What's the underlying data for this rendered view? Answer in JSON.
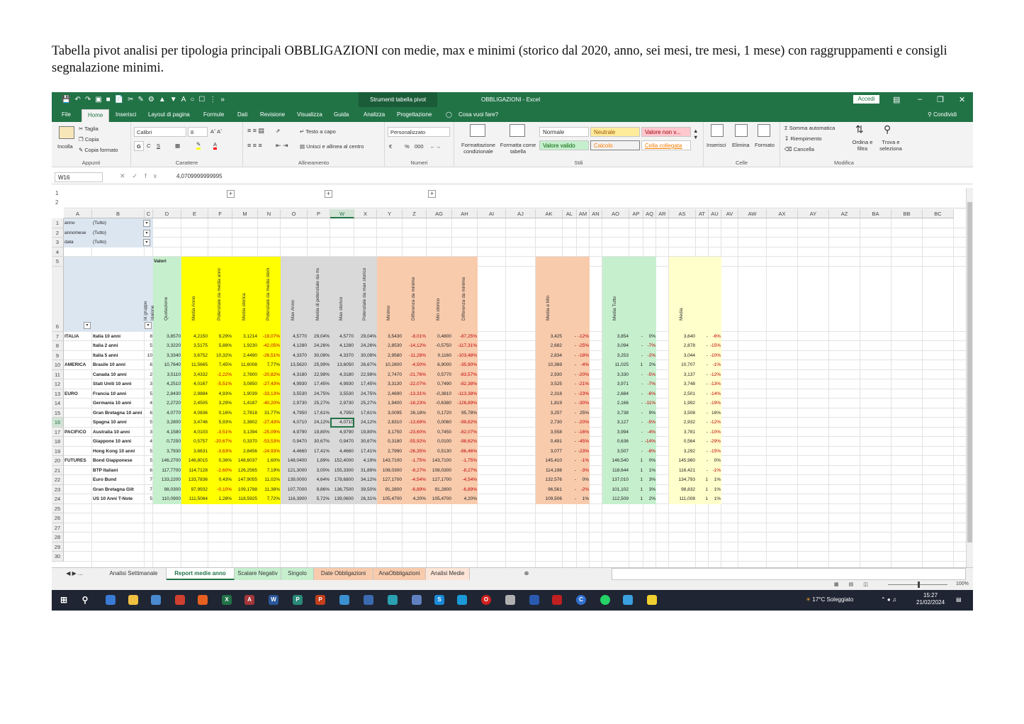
{
  "intro_text": "Tabella pivot analisi per tipologia principali OBBLIGAZIONI con medie, max e minimi (storico dal 2020, anno, sei mesi, tre mesi, 1 mese) con raggruppamenti e consigli segnalazione minimi.",
  "window": {
    "context_tab": "Strumenti tabella pivot",
    "title": "OBBLIGAZIONI - Excel",
    "signin": "Accedi",
    "share": "Condividi",
    "search": "Cosa vuoi fare?"
  },
  "ribbon_tabs": [
    "File",
    "Home",
    "Inserisci",
    "Layout di pagina",
    "Formule",
    "Dati",
    "Revisione",
    "Visualizza",
    "Guida",
    "Analizza",
    "Progettazione"
  ],
  "ribbon": {
    "clipboard": {
      "label": "Appunti",
      "paste": "Incolla",
      "cut": "Taglia",
      "copy": "Copia",
      "format_painter": "Copia formato"
    },
    "font": {
      "label": "Carattere",
      "name": "Calibri",
      "size": "8",
      "bold": "G",
      "italic": "C",
      "underline": "S"
    },
    "alignment": {
      "label": "Allineamento",
      "wrap": "Testo a capo",
      "merge": "Unisci e allinea al centro"
    },
    "number": {
      "label": "Numeri",
      "format": "Personalizzato",
      "percent": "%",
      "thousands": "000"
    },
    "styles": {
      "label": "Stili",
      "cond_format": "Formattazione condizionale",
      "format_table": "Formatta come tabella",
      "normale": "Normale",
      "neutrale": "Neutrale",
      "non_valido": "Valore non v...",
      "valido": "Valore valido",
      "calcolo": "Calcolo",
      "collegata": "Cella collegata"
    },
    "cells": {
      "label": "Celle",
      "insert": "Inserisci",
      "delete": "Elimina",
      "format": "Formato"
    },
    "editing": {
      "label": "Modifica",
      "autosum": "Somma automatica",
      "fill": "Riempimento",
      "clear": "Cancella",
      "sort": "Ordina e filtra",
      "find": "Trova e seleziona"
    }
  },
  "formula_bar": {
    "name_box": "W16",
    "fx": "fx",
    "value": "4,0709999999995"
  },
  "columns": [
    "A",
    "B",
    "C",
    "D",
    "E",
    "F",
    "M",
    "N",
    "O",
    "P",
    "W",
    "X",
    "Y",
    "Z",
    "AG",
    "AH",
    "AI",
    "AJ",
    "AK",
    "AL",
    "AM",
    "AN",
    "AO",
    "AP",
    "AQ",
    "AR",
    "AS",
    "AT",
    "AU",
    "AV",
    "AW",
    "AX",
    "AY",
    "AZ",
    "BA",
    "BB",
    "BC"
  ],
  "row_numbers": [
    "1",
    "2",
    "3",
    "4",
    "5",
    "6",
    "7",
    "8",
    "9",
    "10",
    "11",
    "12",
    "13",
    "14",
    "15",
    "16",
    "17",
    "18",
    "19",
    "20",
    "21",
    "22",
    "23",
    "24",
    "25",
    "26",
    "27",
    "28",
    "29",
    "30"
  ],
  "outline_levels": [
    "1",
    "2"
  ],
  "filters": [
    {
      "field": "anno",
      "value": "(Tutto)"
    },
    {
      "field": "annomese",
      "value": "(Tutto)"
    },
    {
      "field": "data",
      "value": "(Tutto)"
    }
  ],
  "values_label": "Valori",
  "headers": {
    "C": "Id gruppo",
    "C2": "Idalone",
    "D": "Quotazione",
    "E": "Media Anno",
    "F": "Potenziale da media anno",
    "M": "Media storica",
    "N": "Potenziale da media storica",
    "O": "Max Anno",
    "P": "Media di potenziale da max",
    "W": "Max storico",
    "X": "Potenziale da max storico",
    "Y": "Minimo",
    "Z": "Differenza da minimo",
    "AG": "Min storico",
    "AH": "Differenza da minimo",
    "AK": "Media e Min",
    "AO": "Media Tutto",
    "AS": "Media"
  },
  "rows": [
    {
      "r": "7",
      "g": "ITALIA",
      "b": "Italia 10 anni",
      "c": "8",
      "d": "3,8570",
      "e": "4,2150",
      "f": "9,29%",
      "m": "3,1214",
      "n": "-19,07%",
      "o": "4,5770",
      "p": "29,04%",
      "w": "4,5770",
      "x": "29,04%",
      "y": "3,5430",
      "z": "-8,01%",
      "ag": "0,4800",
      "ah": "-87,25%",
      "ak": "3,425",
      "al": "-",
      "am": "-12%",
      "ao": "3,854",
      "ap": "-",
      "aq": "0%",
      "as": "3,640",
      "at": "-",
      "au": "-6%"
    },
    {
      "r": "8",
      "g": "",
      "b": "Italia 2 anni",
      "c": "5",
      "d": "3,3220",
      "e": "3,5175",
      "f": "5,88%",
      "m": "1,9230",
      "n": "-42,05%",
      "o": "4,1280",
      "p": "24,26%",
      "w": "4,1280",
      "x": "24,26%",
      "y": "2,8530",
      "z": "-14,12%",
      "ag": "-0,5750",
      "ah": "-117,31%",
      "ak": "2,682",
      "al": "-",
      "am": "-25%",
      "ao": "3,094",
      "ap": "-",
      "aq": "-7%",
      "as": "2,878",
      "at": "-",
      "au": "-15%"
    },
    {
      "r": "9",
      "g": "",
      "b": "Italia 5 anni",
      "c": "10",
      "d": "3,3340",
      "e": "3,6752",
      "f": "10,32%",
      "m": "2,4490",
      "n": "-26,51%",
      "o": "4,3370",
      "p": "30,08%",
      "w": "4,3370",
      "x": "30,08%",
      "y": "2,9580",
      "z": "-11,28%",
      "ag": "0,1160",
      "ah": "-103,48%",
      "ak": "2,834",
      "al": "-",
      "am": "-18%",
      "ao": "3,253",
      "ap": "-",
      "aq": "-2%",
      "as": "3,044",
      "at": "-",
      "au": "-10%"
    },
    {
      "r": "10",
      "g": "AMERICA",
      "b": "Brasile 10 anni",
      "c": "6",
      "d": "10,7640",
      "e": "11,5665",
      "f": "7,45%",
      "m": "11,6008",
      "n": "7,77%",
      "o": "13,5620",
      "p": "25,99%",
      "w": "13,6050",
      "x": "26,67%",
      "y": "10,2800",
      "z": "-4,50%",
      "ag": "6,9000",
      "ah": "-35,90%",
      "ak": "10,369",
      "al": "-",
      "am": "-4%",
      "ao": "11,025",
      "ap": "1",
      "aq": "2%",
      "as": "10,707",
      "at": "-",
      "au": "-1%"
    },
    {
      "r": "11",
      "g": "",
      "b": "Canada 10 anni",
      "c": "2",
      "d": "3,5110",
      "e": "3,4332",
      "f": "-2,22%",
      "m": "2,7800",
      "n": "-20,82%",
      "o": "4,3180",
      "p": "22,98%",
      "w": "4,3180",
      "x": "22,98%",
      "y": "2,7470",
      "z": "-21,76%",
      "ag": "0,5770",
      "ah": "-83,57%",
      "ak": "2,930",
      "al": "-",
      "am": "-20%",
      "ao": "3,330",
      "ap": "-",
      "aq": "-5%",
      "as": "3,137",
      "at": "-",
      "au": "-12%"
    },
    {
      "r": "12",
      "g": "",
      "b": "Stati Uniti 10 anni",
      "c": "3",
      "d": "4,2510",
      "e": "4,0167",
      "f": "-5,51%",
      "m": "3,0850",
      "n": "-27,43%",
      "o": "4,9930",
      "p": "17,45%",
      "w": "4,9930",
      "x": "17,45%",
      "y": "3,3130",
      "z": "-22,07%",
      "ag": "0,7490",
      "ah": "-82,38%",
      "ak": "3,525",
      "al": "-",
      "am": "-21%",
      "ao": "3,971",
      "ap": "-",
      "aq": "-7%",
      "as": "3,748",
      "at": "-",
      "au": "-13%"
    },
    {
      "r": "13",
      "g": "EURO",
      "b": "Francia 10 anni",
      "c": "5",
      "d": "2,8430",
      "e": "2,9884",
      "f": "4,93%",
      "m": "1,9039",
      "n": "-33,13%",
      "o": "3,5530",
      "p": "24,75%",
      "w": "3,5530",
      "x": "24,75%",
      "y": "2,4690",
      "z": "-13,31%",
      "ag": "-0,3810",
      "ah": "-113,38%",
      "ak": "2,318",
      "al": "-",
      "am": "-23%",
      "ao": "2,684",
      "ap": "-",
      "aq": "-6%",
      "as": "2,501",
      "at": "-",
      "au": "-14%"
    },
    {
      "r": "14",
      "g": "",
      "b": "Germania 10 anni",
      "c": "4",
      "d": "2,2720",
      "e": "2,4505",
      "f": "3,29%",
      "m": "1,4187",
      "n": "-40,20%",
      "o": "2,9730",
      "p": "25,27%",
      "w": "2,9730",
      "x": "25,27%",
      "y": "1,9400",
      "z": "-18,23%",
      "ag": "-0,6380",
      "ah": "-126,89%",
      "ak": "1,819",
      "al": "-",
      "am": "-30%",
      "ao": "2,166",
      "ap": "-",
      "aq": "-11%",
      "as": "1,992",
      "at": "-",
      "au": "-19%"
    },
    {
      "r": "15",
      "g": "",
      "b": "Gran Bretagna 10 anni",
      "c": "6",
      "d": "4,0770",
      "e": "4,0836",
      "f": "0,16%",
      "m": "2,7818",
      "n": "31,77%",
      "o": "4,7950",
      "p": "17,61%",
      "w": "4,7950",
      "x": "17,61%",
      "y": "3,0095",
      "z": "26,18%",
      "ag": "0,1720",
      "ah": "95,78%",
      "ak": "3,257",
      "al": "-",
      "am": "25%",
      "ao": "3,738",
      "ap": "-",
      "aq": "9%",
      "as": "3,508",
      "at": "-",
      "au": "16%"
    },
    {
      "r": "16",
      "g": "",
      "b": "Spagna 10 anni",
      "c": "5",
      "d": "3,2800",
      "e": "3,4746",
      "f": "5,93%",
      "m": "2,3802",
      "n": "-27,43%",
      "o": "4,0710",
      "p": "24,12%",
      "w": "4,0710",
      "x": "24,12%",
      "y": "2,8310",
      "z": "-13,69%",
      "ag": "0,0060",
      "ah": "-99,82%",
      "ak": "2,730",
      "al": "-",
      "am": "-20%",
      "ao": "3,127",
      "ap": "-",
      "aq": "-5%",
      "as": "2,932",
      "at": "-",
      "au": "-12%"
    },
    {
      "r": "17",
      "g": "PACIFICO",
      "b": "Australia 10 anni",
      "c": "3",
      "d": "4,1580",
      "e": "4,0103",
      "f": "-3,51%",
      "m": "3,1394",
      "n": "-25,09%",
      "o": "4,9790",
      "p": "19,80%",
      "w": "4,9790",
      "x": "19,80%",
      "y": "3,1750",
      "z": "-23,60%",
      "ag": "0,7450",
      "ah": "-82,07%",
      "ak": "3,558",
      "al": "-",
      "am": "-16%",
      "ao": "3,994",
      "ap": "-",
      "aq": "-4%",
      "as": "3,781",
      "at": "-",
      "au": "-10%"
    },
    {
      "r": "18",
      "g": "",
      "b": "Giappone 10 anni",
      "c": "4",
      "d": "0,7250",
      "e": "0,5757",
      "f": "-20,67%",
      "m": "0,3370",
      "n": "-53,53%",
      "o": "0,9470",
      "p": "30,67%",
      "w": "0,9470",
      "x": "30,67%",
      "y": "0,3180",
      "z": "-55,92%",
      "ag": "0,0100",
      "ah": "-98,62%",
      "ak": "0,491",
      "al": "-",
      "am": "-45%",
      "ao": "0,636",
      "ap": "-",
      "aq": "-14%",
      "as": "0,564",
      "at": "-",
      "au": "-29%"
    },
    {
      "r": "19",
      "g": "",
      "b": "Hong Kong 10 anni",
      "c": "5",
      "d": "3,7930",
      "e": "3,6631",
      "f": "-3,63%",
      "m": "2,8456",
      "n": "-24,93%",
      "o": "4,4660",
      "p": "17,41%",
      "w": "4,4660",
      "x": "17,41%",
      "y": "2,7990",
      "z": "-26,35%",
      "ag": "0,5130",
      "ah": "-86,46%",
      "ak": "3,077",
      "al": "-",
      "am": "-23%",
      "ao": "3,507",
      "ap": "-",
      "aq": "-8%",
      "as": "3,292",
      "at": "-",
      "au": "-15%"
    },
    {
      "r": "20",
      "g": "FUTURES",
      "b": "Bond Giapponese",
      "c": "5",
      "d": "146,2700",
      "e": "146,8015",
      "f": "0,36%",
      "m": "148,6037",
      "n": "1,60%",
      "o": "148,0400",
      "p": "1,89%",
      "w": "152,4000",
      "x": "4,19%",
      "y": "143,7100",
      "z": "-1,75%",
      "ag": "143,7100",
      "ah": "-1,75%",
      "ak": "145,410",
      "al": "-",
      "am": "-1%",
      "ao": "146,540",
      "ap": "1",
      "aq": "0%",
      "as": "145,980",
      "at": "-",
      "au": "0%"
    },
    {
      "r": "21",
      "g": "",
      "b": "BTP Italiani",
      "c": "6",
      "d": "117,7700",
      "e": "114,7128",
      "f": "-2,60%",
      "m": "126,2565",
      "n": "7,19%",
      "o": "121,3000",
      "p": "3,00%",
      "w": "155,3300",
      "x": "31,89%",
      "y": "108,0300",
      "z": "-8,27%",
      "ag": "108,0300",
      "ah": "-8,27%",
      "ak": "114,198",
      "al": "-",
      "am": "-3%",
      "ao": "118,644",
      "ap": "1",
      "aq": "1%",
      "as": "116,421",
      "at": "-",
      "au": "-1%"
    },
    {
      "r": "22",
      "g": "",
      "b": "Euro Bund",
      "c": "7",
      "d": "133,2200",
      "e": "133,7836",
      "f": "0,43%",
      "m": "147,9055",
      "n": "11,02%",
      "o": "139,0000",
      "p": "4,64%",
      "w": "178,6800",
      "x": "34,12%",
      "y": "127,1700",
      "z": "-4,54%",
      "ag": "127,1700",
      "ah": "-4,54%",
      "ak": "132,576",
      "al": "-",
      "am": "0%",
      "ao": "137,010",
      "ap": "1",
      "aq": "3%",
      "as": "134,793",
      "at": "1",
      "au": "1%"
    },
    {
      "r": "23",
      "g": "",
      "b": "Gran Bretagna Gilt",
      "c": "7",
      "d": "98,0300",
      "e": "97,9932",
      "f": "-0,10%",
      "m": "109,1788",
      "n": "11,38%",
      "o": "107,7000",
      "p": "9,86%",
      "w": "136,7500",
      "x": "39,50%",
      "y": "91,2800",
      "z": "-6,89%",
      "ag": "91,2800",
      "ah": "-6,89%",
      "ak": "96,561",
      "al": "-",
      "am": "-2%",
      "ao": "101,102",
      "ap": "1",
      "aq": "3%",
      "as": "98,832",
      "at": "1",
      "au": "1%"
    },
    {
      "r": "24",
      "g": "",
      "b": "US 10 Anni T-Note",
      "c": "5",
      "d": "110,0900",
      "e": "111,5064",
      "f": "1,28%",
      "m": "118,5925",
      "n": "7,72%",
      "o": "116,3900",
      "p": "5,72%",
      "w": "139,0600",
      "x": "26,31%",
      "y": "105,4700",
      "z": "4,20%",
      "ag": "105,4700",
      "ah": "4,20%",
      "ak": "109,506",
      "al": "-",
      "am": "1%",
      "ao": "112,509",
      "ap": "1",
      "aq": "2%",
      "as": "111,008",
      "at": "1",
      "au": "1%"
    }
  ],
  "sheet_tabs": [
    {
      "label": "Analisi Settimanale",
      "color": "#f0f0f0",
      "active": false
    },
    {
      "label": "Report medie anno",
      "color": "#ffffff",
      "active": true
    },
    {
      "label": "Scalare Negativ",
      "color": "#c6efce",
      "active": false
    },
    {
      "label": "Singolo",
      "color": "#c6efce",
      "active": false
    },
    {
      "label": "Date Obbligazioni",
      "color": "#f8cbad",
      "active": false
    },
    {
      "label": "AnaObbligazioni",
      "color": "#f8cbad",
      "active": false
    },
    {
      "label": "Analisi Medie",
      "color": "#fce4d6",
      "active": false
    }
  ],
  "status": {
    "zoom": "100%"
  },
  "taskbar": {
    "weather": "17°C Soleggiato",
    "time": "15:27",
    "date": "21/02/2024"
  },
  "colors": {
    "excel_green": "#217346",
    "yellow": "#ffff00",
    "light_green": "#c6efce",
    "gray": "#d9d9d9",
    "salmon": "#f8cbad",
    "light_yellow": "#ffffcc",
    "pivot_header": "#dce6f1",
    "negative": "#c00000"
  }
}
